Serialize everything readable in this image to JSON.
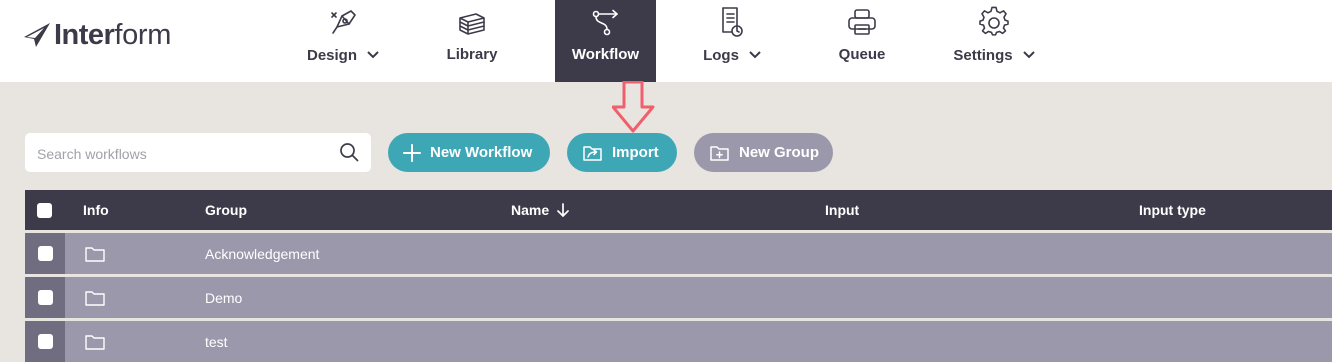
{
  "app": {
    "logo_bold": "Inter",
    "logo_thin": "form"
  },
  "nav": {
    "items": [
      {
        "label": "Design",
        "icon": "pen-nib-icon",
        "has_dropdown": true,
        "active": false
      },
      {
        "label": "Library",
        "icon": "books-stack-icon",
        "has_dropdown": false,
        "active": false
      },
      {
        "label": "Workflow",
        "icon": "workflow-branch-icon",
        "has_dropdown": false,
        "active": true
      },
      {
        "label": "Logs",
        "icon": "log-document-clock-icon",
        "has_dropdown": true,
        "active": false
      },
      {
        "label": "Queue",
        "icon": "printer-icon",
        "has_dropdown": false,
        "active": false
      },
      {
        "label": "Settings",
        "icon": "gear-icon",
        "has_dropdown": true,
        "active": false
      }
    ]
  },
  "toolbar": {
    "search_placeholder": "Search workflows",
    "new_workflow_label": "New Workflow",
    "import_label": "Import",
    "new_group_label": "New Group"
  },
  "table": {
    "columns": [
      "Info",
      "Group",
      "Name",
      "Input",
      "Input type"
    ],
    "sorted_column": "Name",
    "sort_direction": "descending",
    "rows": [
      {
        "group": "Acknowledgement",
        "icon": "folder-icon"
      },
      {
        "group": "Demo",
        "icon": "folder-icon"
      },
      {
        "group": "test",
        "icon": "folder-icon"
      }
    ]
  },
  "colors": {
    "nav_dark": "#3d3b49",
    "accent_teal": "#3ea7b6",
    "row_grey": "#9b98ac",
    "background": "#e8e5e1",
    "annotation_red": "#f0606a"
  }
}
